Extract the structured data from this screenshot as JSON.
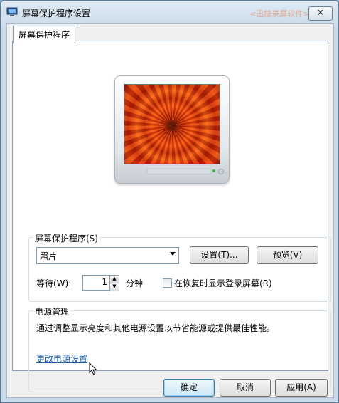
{
  "window": {
    "title": "屏幕保护程序设置",
    "title_ghost_text": "<迅捷录屏软件>",
    "close_symbol": "✕",
    "icon": "screensaver-monitor-icon"
  },
  "tab": {
    "label": "屏幕保护程序"
  },
  "preview": {
    "image": "red-chrysanthemum-flower"
  },
  "screensaver_group": {
    "legend": "屏幕保护程序(S)",
    "selected": "照片",
    "settings_label": "设置(T)...",
    "preview_label": "预览(V)",
    "wait_label": "等待(W):",
    "wait_value": "1",
    "minutes_label": "分钟",
    "resume_checkbox_label": "在恢复时显示登录屏幕(R)",
    "resume_checked": false
  },
  "power_group": {
    "legend": "电源管理",
    "description": "通过调整显示亮度和其他电源设置以节省能源或提供最佳性能。",
    "link_label": "更改电源设置"
  },
  "footer": {
    "ok_label": "确定",
    "cancel_label": "取消",
    "apply_label": "应用(A)"
  },
  "colors": {
    "link": "#1b5ca8",
    "accent": "#3c7fb1"
  }
}
